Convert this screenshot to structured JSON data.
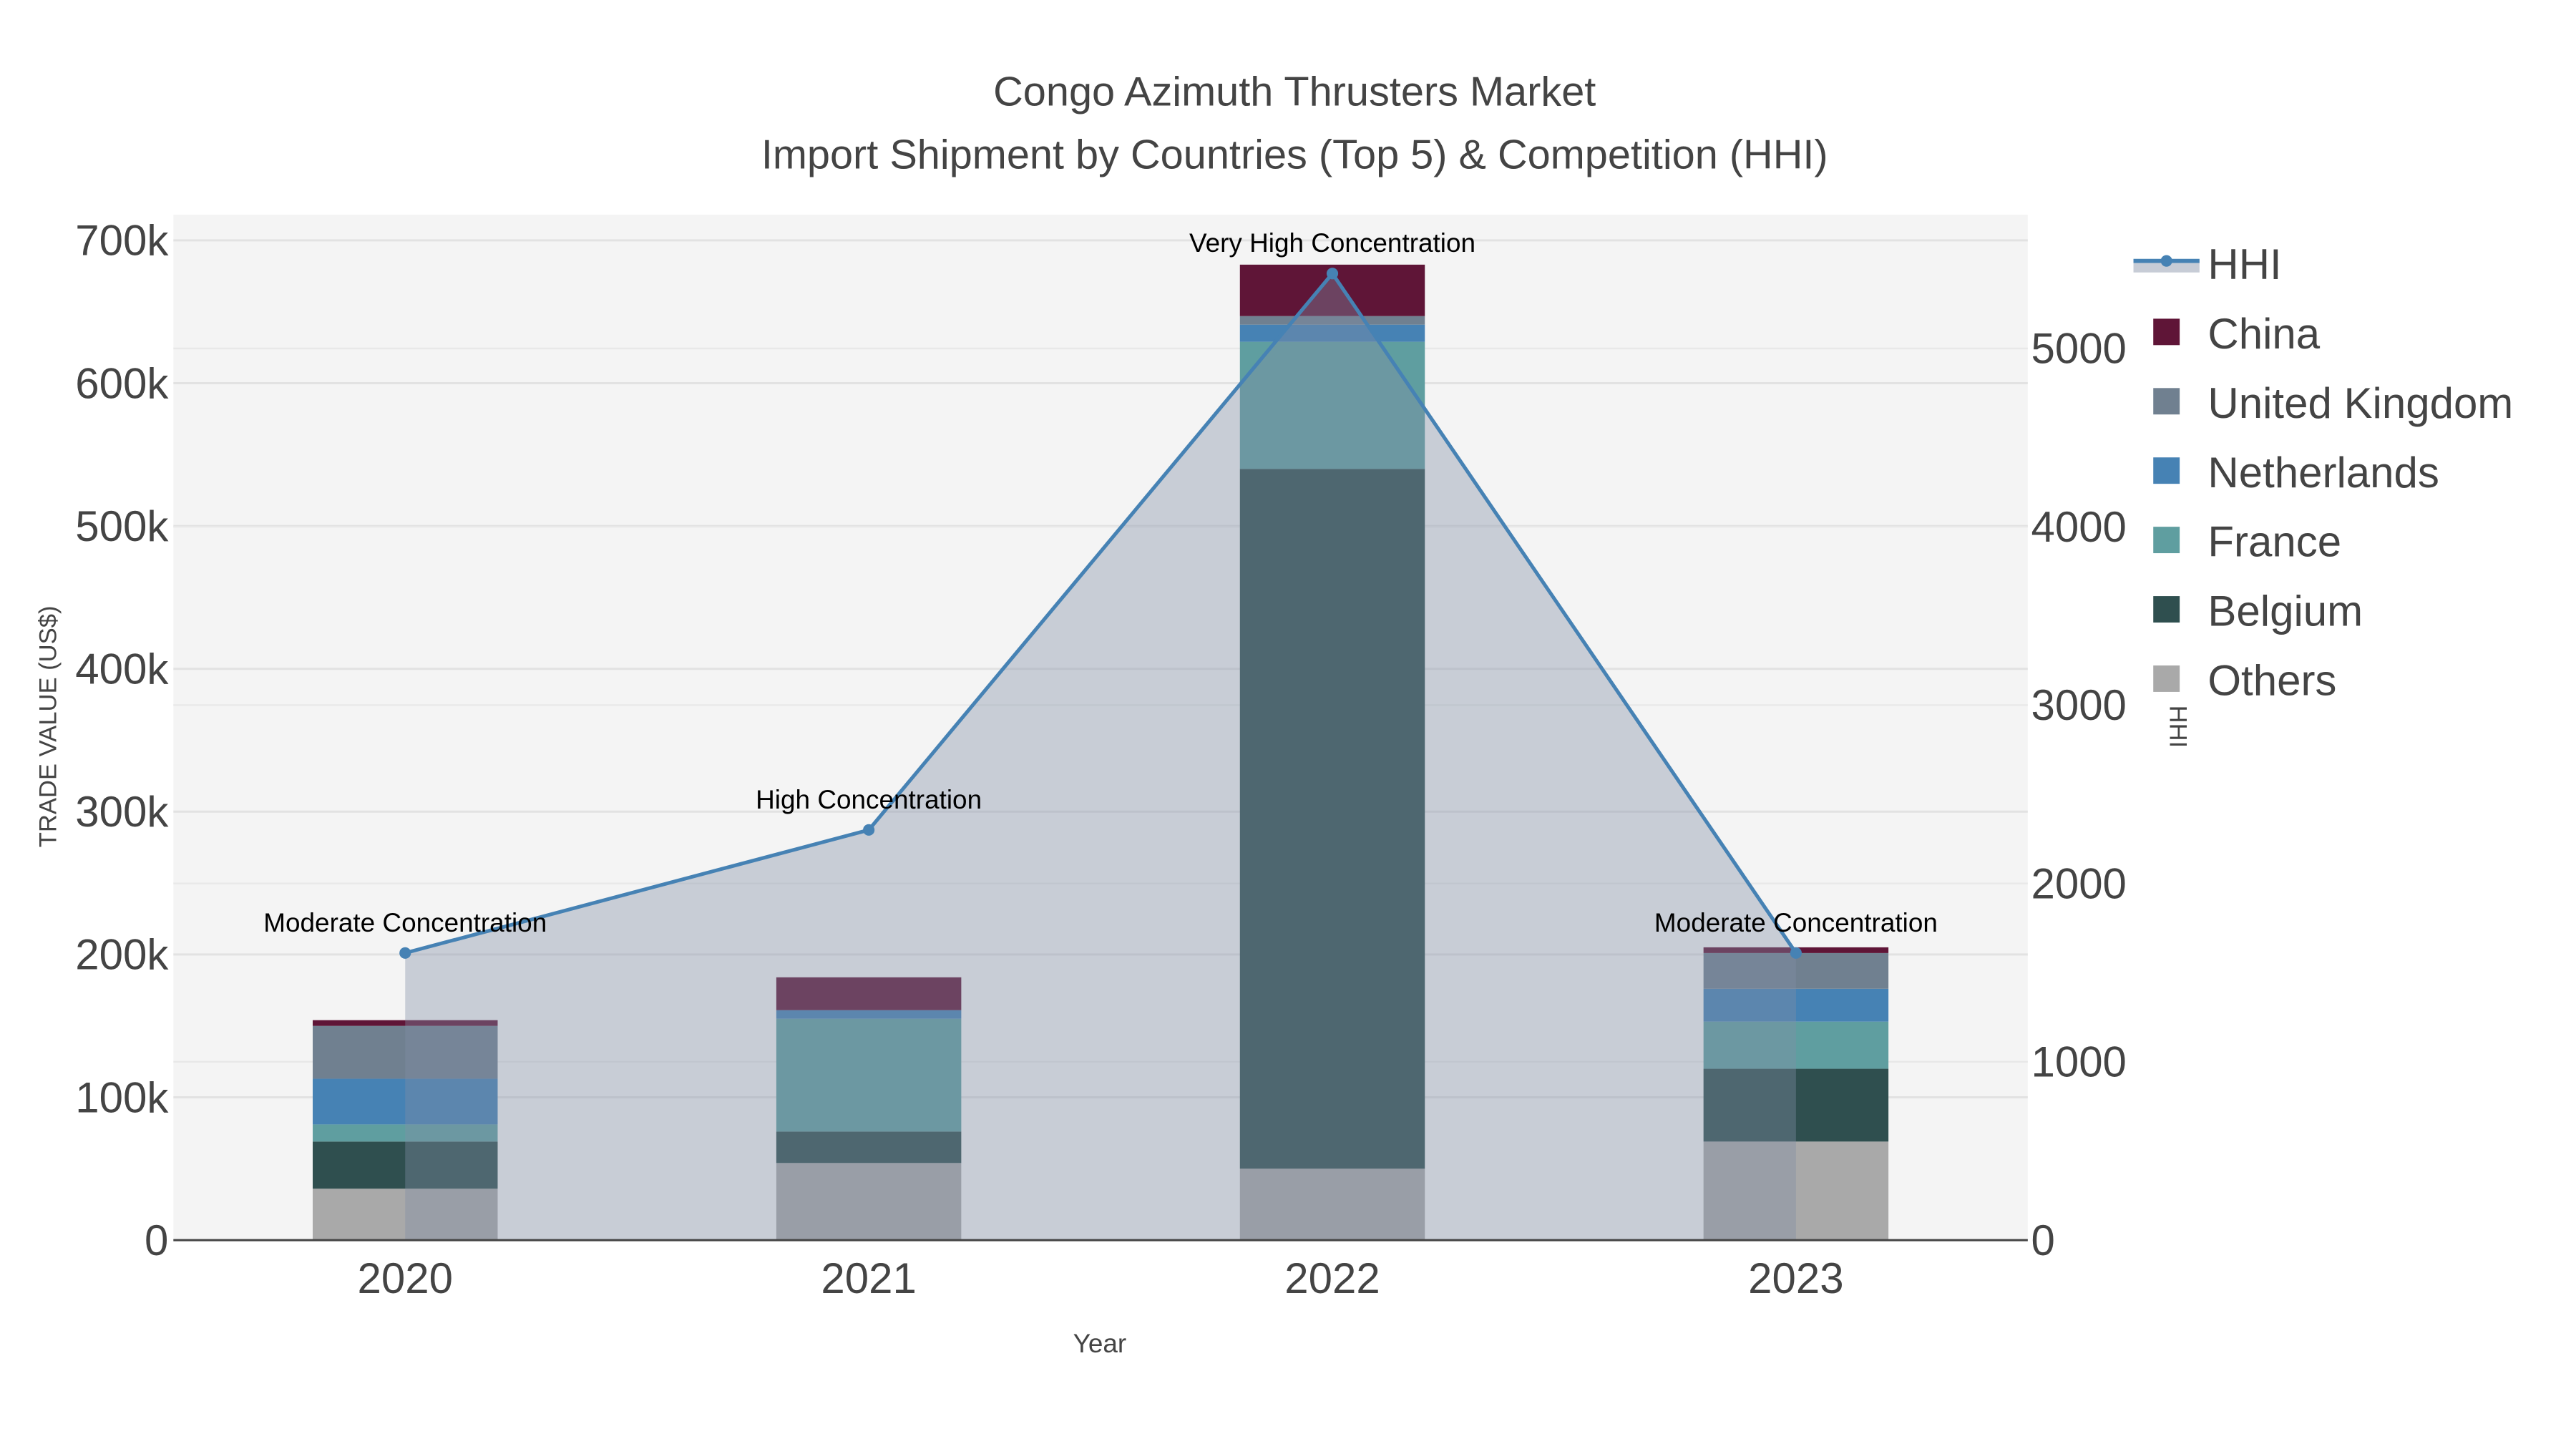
{
  "chart_data": {
    "type": "bar",
    "title": "Congo Azimuth Thrusters Market",
    "subtitle": "Import Shipment by Countries (Top 5) & Competition (HHI)",
    "xlabel": "Year",
    "ylabel": "TRADE VALUE (US$)",
    "y2label": "HHI",
    "categories": [
      "2020",
      "2021",
      "2022",
      "2023"
    ],
    "ylim": [
      0,
      718000
    ],
    "y2lim": [
      0,
      5750
    ],
    "yticks": [
      0,
      100000,
      200000,
      300000,
      400000,
      500000,
      600000,
      700000
    ],
    "ytick_labels": [
      "0",
      "100k",
      "200k",
      "300k",
      "400k",
      "500k",
      "600k",
      "700k"
    ],
    "y2ticks": [
      0,
      1000,
      2000,
      3000,
      4000,
      5000
    ],
    "y2tick_labels": [
      "0",
      "1000",
      "2000",
      "3000",
      "4000",
      "5000"
    ],
    "stacked": true,
    "series": [
      {
        "name": "Others",
        "color": "#a9a9a9",
        "values": [
          36000,
          54000,
          50000,
          69000
        ]
      },
      {
        "name": "Belgium",
        "color": "#2f4f4f",
        "values": [
          33000,
          22000,
          490000,
          51000
        ]
      },
      {
        "name": "France",
        "color": "#5f9ea0",
        "values": [
          12000,
          79000,
          89000,
          33000
        ]
      },
      {
        "name": "Netherlands",
        "color": "#4682b4",
        "values": [
          32000,
          6000,
          12000,
          23000
        ]
      },
      {
        "name": "United Kingdom",
        "color": "#708090",
        "values": [
          37000,
          0,
          6000,
          25000
        ]
      },
      {
        "name": "China",
        "color": "#5f1537",
        "values": [
          4000,
          23000,
          36000,
          4000
        ]
      }
    ],
    "hhi": {
      "name": "HHI",
      "color": "#4682b4",
      "values": [
        1610,
        2300,
        5420,
        1610
      ],
      "annotations": [
        "Moderate Concentration",
        "High Concentration",
        "Very High Concentration",
        "Moderate Concentration"
      ]
    },
    "legend": [
      "HHI",
      "China",
      "United Kingdom",
      "Netherlands",
      "France",
      "Belgium",
      "Others"
    ],
    "legend_position": "right",
    "grid": true
  }
}
